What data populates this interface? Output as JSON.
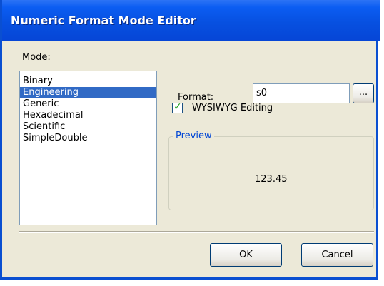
{
  "window": {
    "title": "Numeric Format Mode Editor"
  },
  "mode": {
    "label": "Mode:",
    "items": [
      "Binary",
      "Engineering",
      "Generic",
      "Hexadecimal",
      "Scientific",
      "SimpleDouble"
    ],
    "selected": "Engineering"
  },
  "format": {
    "label": "Format:",
    "value": "s0",
    "browse_label": "..."
  },
  "wysiwyg": {
    "label": "WYSIWYG Editing",
    "checked": true
  },
  "preview": {
    "legend": "Preview",
    "value": "123.45"
  },
  "buttons": {
    "ok": "OK",
    "cancel": "Cancel"
  },
  "colors": {
    "titlebar": "#0750e0",
    "selection": "#316ac5",
    "legend": "#0046d5",
    "check": "#21a121"
  }
}
